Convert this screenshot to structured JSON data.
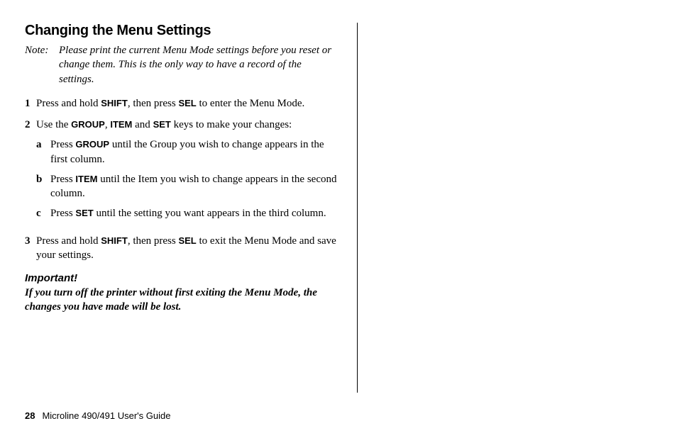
{
  "heading": "Changing the Menu Settings",
  "note": {
    "label": "Note:",
    "text": "Please print the current Menu Mode settings before you reset or change them. This is the only way to have a record of the settings."
  },
  "steps": {
    "s1": {
      "num": "1",
      "t1": "Press and hold ",
      "k1": "SHIFT",
      "t2": ", then press ",
      "k2": "SEL",
      "t3": " to enter the Menu Mode."
    },
    "s2": {
      "num": "2",
      "t1": "Use the ",
      "k1": "GROUP",
      "t2": ", ",
      "k2": "ITEM",
      "t3": " and ",
      "k3": "SET",
      "t4": " keys to make your changes:"
    },
    "sa": {
      "num": "a",
      "t1": "Press ",
      "k1": "GROUP",
      "t2": " until the Group you wish to change appears in the first column."
    },
    "sb": {
      "num": "b",
      "t1": "Press ",
      "k1": "ITEM",
      "t2": " until the Item you wish to change appears in the second column."
    },
    "sc": {
      "num": "c",
      "t1": "Press ",
      "k1": "SET",
      "t2": " until the setting you want appears in the third column."
    },
    "s3": {
      "num": "3",
      "t1": "Press and hold ",
      "k1": "SHIFT",
      "t2": ", then press ",
      "k2": "SEL",
      "t3": " to exit the Menu Mode and save your settings."
    }
  },
  "important": {
    "label": "Important!",
    "text": "If you turn off the printer without first exiting the Menu Mode, the changes you have made will be lost."
  },
  "footer": {
    "page": "28",
    "title": "Microline 490/491 User's Guide"
  }
}
